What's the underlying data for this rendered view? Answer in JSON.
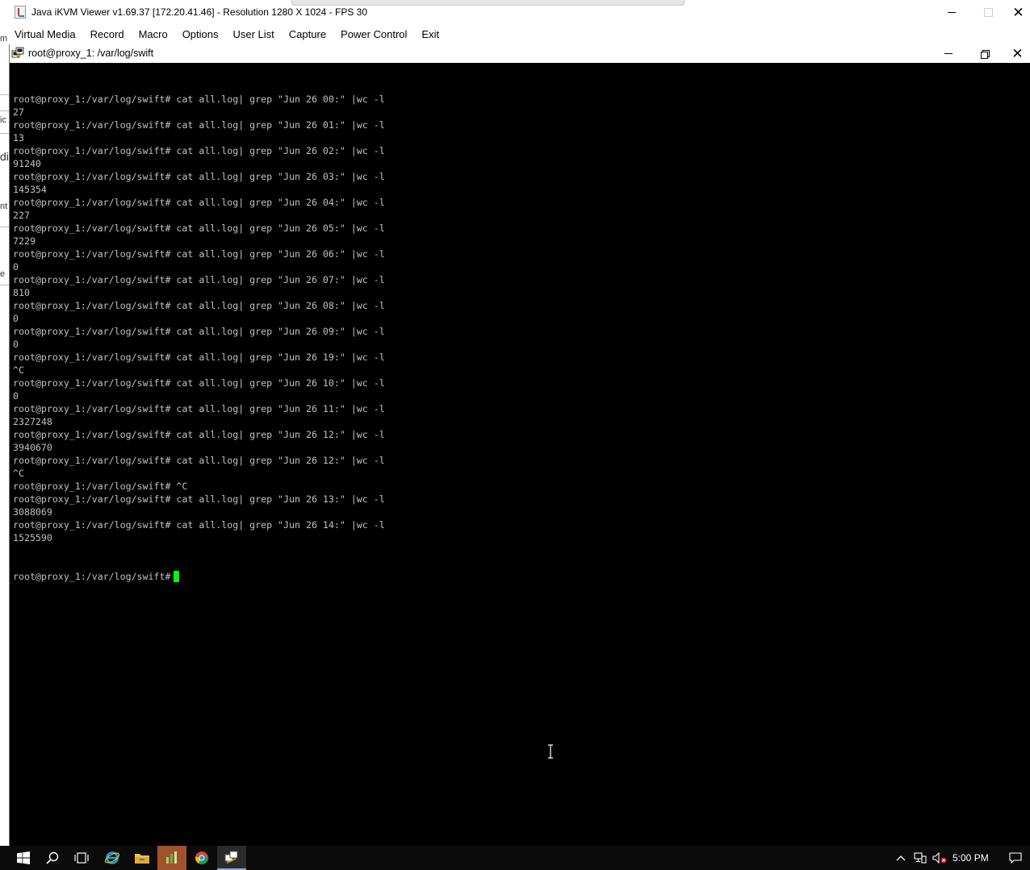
{
  "window": {
    "title": "Java iKVM Viewer v1.69.37 [172.20.41.46]  - Resolution 1280 X 1024 - FPS 30",
    "controls": [
      "minimize-icon",
      "maximize-icon",
      "close-icon"
    ]
  },
  "menubar": {
    "items": [
      "Virtual Media",
      "Record",
      "Macro",
      "Options",
      "User List",
      "Capture",
      "Power Control",
      "Exit"
    ]
  },
  "desktop_behind": {
    "fragments": [
      "m",
      "ic",
      "di",
      "nt",
      "e"
    ]
  },
  "terminal_window": {
    "title": "root@proxy_1: /var/log/swift",
    "icon": "putty-icon"
  },
  "terminal": {
    "lines": [
      "root@proxy_1:/var/log/swift# cat all.log| grep \"Jun 26 00:\" |wc -l",
      "27",
      "root@proxy_1:/var/log/swift# cat all.log| grep \"Jun 26 01:\" |wc -l",
      "13",
      "root@proxy_1:/var/log/swift# cat all.log| grep \"Jun 26 02:\" |wc -l",
      "91240",
      "root@proxy_1:/var/log/swift# cat all.log| grep \"Jun 26 03:\" |wc -l",
      "145354",
      "root@proxy_1:/var/log/swift# cat all.log| grep \"Jun 26 04:\" |wc -l",
      "227",
      "root@proxy_1:/var/log/swift# cat all.log| grep \"Jun 26 05:\" |wc -l",
      "7229",
      "root@proxy_1:/var/log/swift# cat all.log| grep \"Jun 26 06:\" |wc -l",
      "0",
      "root@proxy_1:/var/log/swift# cat all.log| grep \"Jun 26 07:\" |wc -l",
      "810",
      "root@proxy_1:/var/log/swift# cat all.log| grep \"Jun 26 08:\" |wc -l",
      "0",
      "root@proxy_1:/var/log/swift# cat all.log| grep \"Jun 26 09:\" |wc -l",
      "0",
      "root@proxy_1:/var/log/swift# cat all.log| grep \"Jun 26 19:\" |wc -l",
      "^C",
      "root@proxy_1:/var/log/swift# cat all.log| grep \"Jun 26 10:\" |wc -l",
      "0",
      "root@proxy_1:/var/log/swift# cat all.log| grep \"Jun 26 11:\" |wc -l",
      "2327248",
      "root@proxy_1:/var/log/swift# cat all.log| grep \"Jun 26 12:\" |wc -l",
      "3940670",
      "root@proxy_1:/var/log/swift# cat all.log| grep \"Jun 26 12:\" |wc -l",
      "^C",
      "root@proxy_1:/var/log/swift# ^C",
      "root@proxy_1:/var/log/swift# cat all.log| grep \"Jun 26 13:\" |wc -l",
      "3088069",
      "root@proxy_1:/var/log/swift# cat all.log| grep \"Jun 26 14:\" |wc -l",
      "1525590"
    ],
    "prompt": "root@proxy_1:/var/log/swift#",
    "cursor_color": "#00ff00"
  },
  "taskbar": {
    "buttons": [
      "windows-start-icon",
      "search-icon",
      "task-view-icon",
      "internet-explorer-icon",
      "file-explorer-icon",
      "server-manager-icon",
      "chrome-icon",
      "java-kvm-icon"
    ],
    "tray": [
      "show-hidden-icons-icon",
      "network-icon",
      "volume-muted-icon",
      "action-center-icon"
    ],
    "clock": "5:00 PM"
  }
}
